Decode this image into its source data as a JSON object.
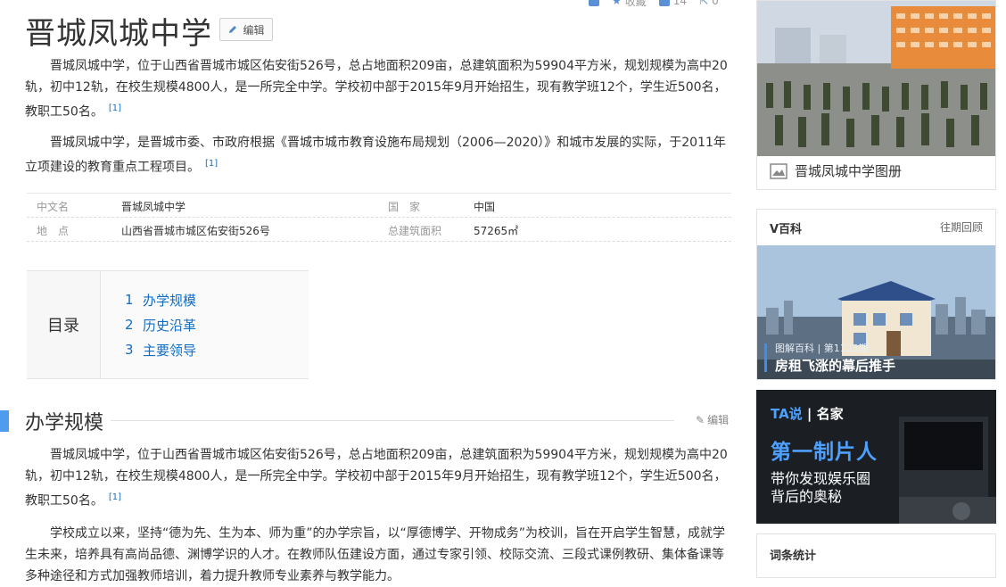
{
  "topbar": {
    "collect_label": "收藏",
    "like_count": "14",
    "share_count": "0"
  },
  "header": {
    "title": "晋城凤城中学",
    "edit_label": "编辑"
  },
  "summary": {
    "p1": "晋城凤城中学，位于山西省晋城市城区佑安街526号，总占地面积209亩，总建筑面积为59904平方米，规划规模为高中20轨，初中12轨，在校生规模4800人，是一所完全中学。学校初中部于2015年9月开始招生，现有教学班12个，学生近500名，教职工50名。",
    "p1_ref": "[1]",
    "p2": "晋城凤城中学，是晋城市委、市政府根据《晋城市城市教育设施布局规划（2006—2020）》和城市发展的实际，于2011年立项建设的教育重点工程项目。",
    "p2_ref": "[1]"
  },
  "basic_info": {
    "rows": [
      {
        "label1": "中文名",
        "value1": "晋城凤城中学",
        "label2": "国　家",
        "value2": "中国"
      },
      {
        "label1": "地　点",
        "value1": "山西省晋城市城区佑安街526号",
        "label2": "总建筑面积",
        "value2": "57265㎡"
      }
    ]
  },
  "catalog": {
    "title": "目录",
    "items": [
      {
        "num": "1",
        "label": "办学规模"
      },
      {
        "num": "2",
        "label": "历史沿革"
      },
      {
        "num": "3",
        "label": "主要领导"
      }
    ]
  },
  "section": {
    "title": "办学规模",
    "edit_label": "编辑",
    "p1": "晋城凤城中学，位于山西省晋城市城区佑安街526号，总占地面积209亩，总建筑面积为59904平方米，规划规模为高中20轨，初中12轨，在校生规模4800人，是一所完全中学。学校初中部于2015年9月开始招生，现有教学班12个，学生近500名，教职工50名。",
    "p1_ref": "[1]",
    "p2": "学校成立以来，坚持“德为先、生为本、师为重”的办学宗旨，以“厚德博学、开物成务”为校训，旨在开启学生智慧，成就学生未来，培养具有高尚品德、渊博学识的人才。在教师队伍建设方面，通过专家引领、校际交流、三段式课例教研、集体备课等多种途径和方式加强教师培训，着力提升教师专业素养与教学能力。"
  },
  "sidebar": {
    "album_caption": "晋城凤城中学图册",
    "vbaike": {
      "title": "V百科",
      "more": "往期回顾",
      "tag": "图解百科 | 第1123期",
      "subtitle": "房租飞涨的幕后推手"
    },
    "ta": {
      "logo_a": "TA说",
      "logo_b": "名家",
      "headline": "第一制片人",
      "line1": "带你发现娱乐圈",
      "line2": "背后的奥秘"
    },
    "stats_title": "词条统计"
  },
  "colors": {
    "link": "#136ec2",
    "accent": "#4f9cee"
  }
}
